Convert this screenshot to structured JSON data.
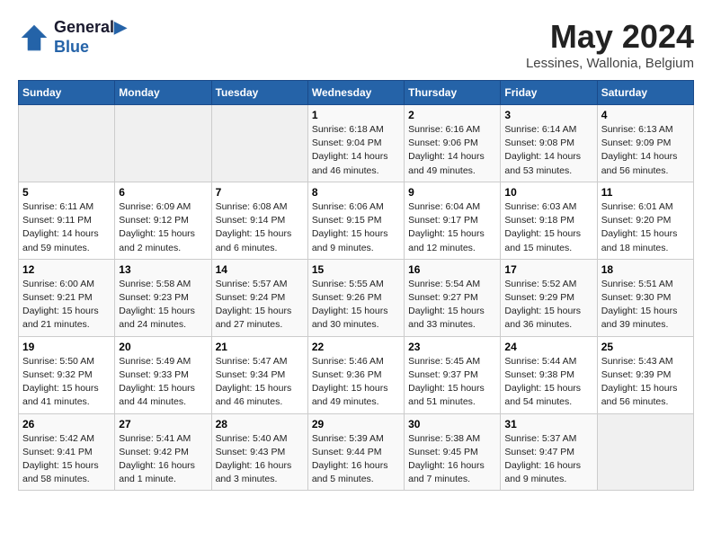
{
  "header": {
    "logo_line1": "General",
    "logo_line2": "Blue",
    "month": "May 2024",
    "location": "Lessines, Wallonia, Belgium"
  },
  "weekdays": [
    "Sunday",
    "Monday",
    "Tuesday",
    "Wednesday",
    "Thursday",
    "Friday",
    "Saturday"
  ],
  "weeks": [
    [
      {
        "day": "",
        "info": ""
      },
      {
        "day": "",
        "info": ""
      },
      {
        "day": "",
        "info": ""
      },
      {
        "day": "1",
        "info": "Sunrise: 6:18 AM\nSunset: 9:04 PM\nDaylight: 14 hours\nand 46 minutes."
      },
      {
        "day": "2",
        "info": "Sunrise: 6:16 AM\nSunset: 9:06 PM\nDaylight: 14 hours\nand 49 minutes."
      },
      {
        "day": "3",
        "info": "Sunrise: 6:14 AM\nSunset: 9:08 PM\nDaylight: 14 hours\nand 53 minutes."
      },
      {
        "day": "4",
        "info": "Sunrise: 6:13 AM\nSunset: 9:09 PM\nDaylight: 14 hours\nand 56 minutes."
      }
    ],
    [
      {
        "day": "5",
        "info": "Sunrise: 6:11 AM\nSunset: 9:11 PM\nDaylight: 14 hours\nand 59 minutes."
      },
      {
        "day": "6",
        "info": "Sunrise: 6:09 AM\nSunset: 9:12 PM\nDaylight: 15 hours\nand 2 minutes."
      },
      {
        "day": "7",
        "info": "Sunrise: 6:08 AM\nSunset: 9:14 PM\nDaylight: 15 hours\nand 6 minutes."
      },
      {
        "day": "8",
        "info": "Sunrise: 6:06 AM\nSunset: 9:15 PM\nDaylight: 15 hours\nand 9 minutes."
      },
      {
        "day": "9",
        "info": "Sunrise: 6:04 AM\nSunset: 9:17 PM\nDaylight: 15 hours\nand 12 minutes."
      },
      {
        "day": "10",
        "info": "Sunrise: 6:03 AM\nSunset: 9:18 PM\nDaylight: 15 hours\nand 15 minutes."
      },
      {
        "day": "11",
        "info": "Sunrise: 6:01 AM\nSunset: 9:20 PM\nDaylight: 15 hours\nand 18 minutes."
      }
    ],
    [
      {
        "day": "12",
        "info": "Sunrise: 6:00 AM\nSunset: 9:21 PM\nDaylight: 15 hours\nand 21 minutes."
      },
      {
        "day": "13",
        "info": "Sunrise: 5:58 AM\nSunset: 9:23 PM\nDaylight: 15 hours\nand 24 minutes."
      },
      {
        "day": "14",
        "info": "Sunrise: 5:57 AM\nSunset: 9:24 PM\nDaylight: 15 hours\nand 27 minutes."
      },
      {
        "day": "15",
        "info": "Sunrise: 5:55 AM\nSunset: 9:26 PM\nDaylight: 15 hours\nand 30 minutes."
      },
      {
        "day": "16",
        "info": "Sunrise: 5:54 AM\nSunset: 9:27 PM\nDaylight: 15 hours\nand 33 minutes."
      },
      {
        "day": "17",
        "info": "Sunrise: 5:52 AM\nSunset: 9:29 PM\nDaylight: 15 hours\nand 36 minutes."
      },
      {
        "day": "18",
        "info": "Sunrise: 5:51 AM\nSunset: 9:30 PM\nDaylight: 15 hours\nand 39 minutes."
      }
    ],
    [
      {
        "day": "19",
        "info": "Sunrise: 5:50 AM\nSunset: 9:32 PM\nDaylight: 15 hours\nand 41 minutes."
      },
      {
        "day": "20",
        "info": "Sunrise: 5:49 AM\nSunset: 9:33 PM\nDaylight: 15 hours\nand 44 minutes."
      },
      {
        "day": "21",
        "info": "Sunrise: 5:47 AM\nSunset: 9:34 PM\nDaylight: 15 hours\nand 46 minutes."
      },
      {
        "day": "22",
        "info": "Sunrise: 5:46 AM\nSunset: 9:36 PM\nDaylight: 15 hours\nand 49 minutes."
      },
      {
        "day": "23",
        "info": "Sunrise: 5:45 AM\nSunset: 9:37 PM\nDaylight: 15 hours\nand 51 minutes."
      },
      {
        "day": "24",
        "info": "Sunrise: 5:44 AM\nSunset: 9:38 PM\nDaylight: 15 hours\nand 54 minutes."
      },
      {
        "day": "25",
        "info": "Sunrise: 5:43 AM\nSunset: 9:39 PM\nDaylight: 15 hours\nand 56 minutes."
      }
    ],
    [
      {
        "day": "26",
        "info": "Sunrise: 5:42 AM\nSunset: 9:41 PM\nDaylight: 15 hours\nand 58 minutes."
      },
      {
        "day": "27",
        "info": "Sunrise: 5:41 AM\nSunset: 9:42 PM\nDaylight: 16 hours\nand 1 minute."
      },
      {
        "day": "28",
        "info": "Sunrise: 5:40 AM\nSunset: 9:43 PM\nDaylight: 16 hours\nand 3 minutes."
      },
      {
        "day": "29",
        "info": "Sunrise: 5:39 AM\nSunset: 9:44 PM\nDaylight: 16 hours\nand 5 minutes."
      },
      {
        "day": "30",
        "info": "Sunrise: 5:38 AM\nSunset: 9:45 PM\nDaylight: 16 hours\nand 7 minutes."
      },
      {
        "day": "31",
        "info": "Sunrise: 5:37 AM\nSunset: 9:47 PM\nDaylight: 16 hours\nand 9 minutes."
      },
      {
        "day": "",
        "info": ""
      }
    ]
  ]
}
